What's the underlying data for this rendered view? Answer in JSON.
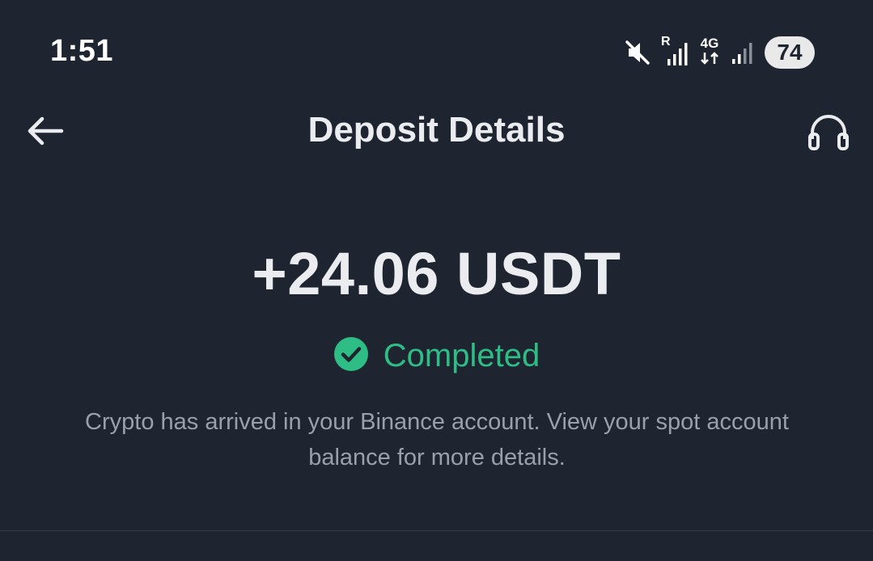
{
  "status_bar": {
    "time": "1:51",
    "battery": "74",
    "network_label": "4G",
    "roaming_label": "R"
  },
  "header": {
    "title": "Deposit Details"
  },
  "deposit": {
    "amount": "+24.06 USDT",
    "status": "Completed",
    "status_color": "#2ebd85",
    "message": "Crypto has arrived in your Binance account. View your spot account balance for more details."
  },
  "icons": {
    "back": "arrow-left-icon",
    "support": "headset-icon",
    "status": "check-circle-icon",
    "mute": "mute-icon"
  }
}
